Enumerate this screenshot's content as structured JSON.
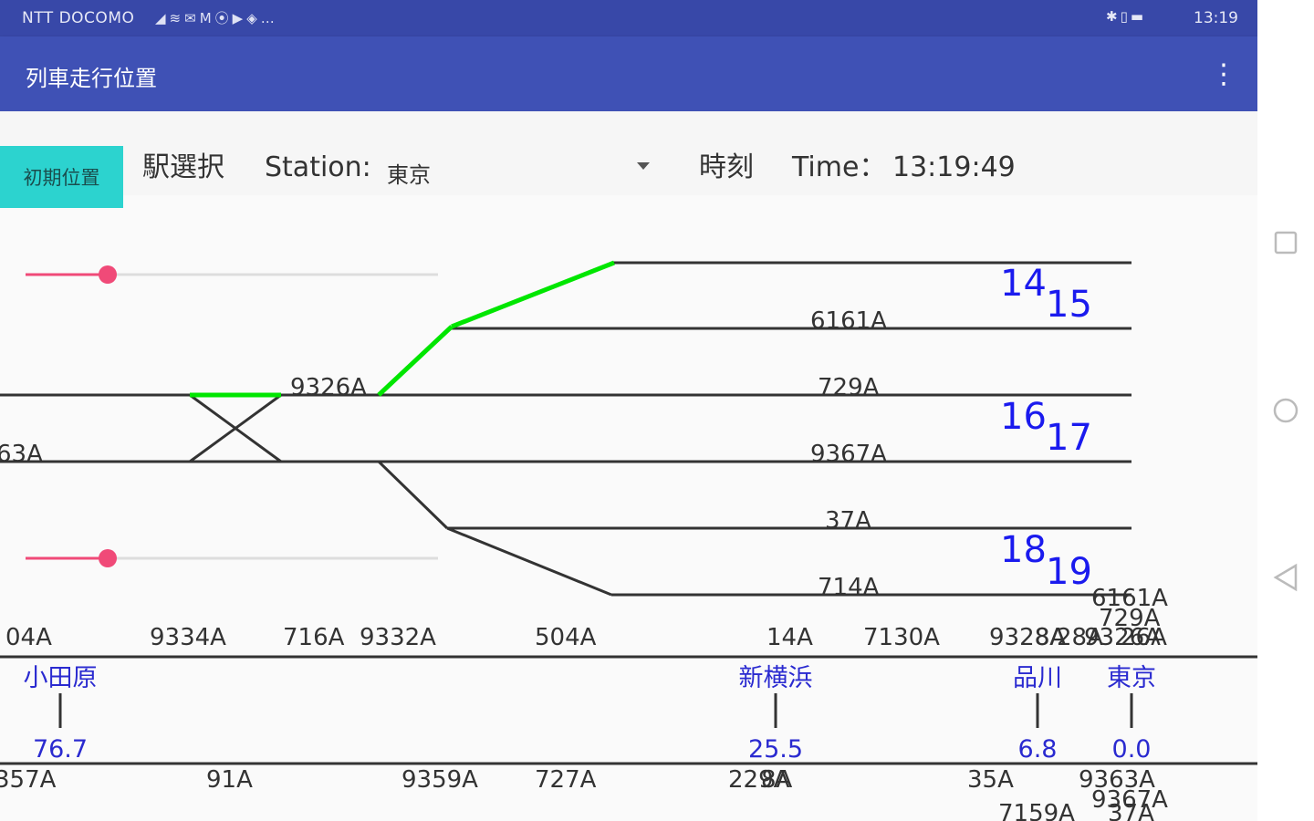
{
  "status_bar": {
    "carrier": "NTT DOCOMO",
    "time": "13:19",
    "signal_icons": [
      "signal-icon",
      "wifi-icon",
      "mail-icon",
      "gmail-icon",
      "record-icon",
      "youtube-icon",
      "dropbox-icon",
      "more-icon"
    ],
    "right_icons": [
      "bluetooth-icon",
      "vibrate-icon",
      "battery-icon"
    ]
  },
  "app_bar": {
    "title": "列車走行位置",
    "menu_icon": "overflow-menu-icon"
  },
  "toolbar": {
    "reset_button": "初期位置",
    "station_select_label": "駅選択",
    "station_label": "Station:",
    "station_value": "東京",
    "time_label_jp": "時刻",
    "time_label": "Time：",
    "time_value": "13:19:49"
  },
  "sliders": [
    {
      "name": "upper-slider",
      "value": 0.2
    },
    {
      "name": "lower-slider",
      "value": 0.2
    }
  ],
  "colors": {
    "status_bar": "#3848a8",
    "app_bar": "#3f51b5",
    "reset_button": "#2cd3cf",
    "active_route": "#00e600",
    "platform_numbers": "#1a1aee",
    "station_labels": "#2a2ad0",
    "slider_accent": "#f04a78"
  },
  "diagram": {
    "platform_pairs": [
      {
        "top": "14",
        "bottom": "15"
      },
      {
        "top": "16",
        "bottom": "17"
      },
      {
        "top": "18",
        "bottom": "19"
      }
    ],
    "track_trains": [
      {
        "label": "6161A"
      },
      {
        "label": "729A"
      },
      {
        "label": "9367A"
      },
      {
        "label": "37A"
      },
      {
        "label": "714A"
      },
      {
        "label": "9326A"
      },
      {
        "label": "63A"
      }
    ],
    "right_stack_trains": [
      {
        "label": "6161A"
      },
      {
        "label": "729A"
      },
      {
        "label": "26A"
      }
    ],
    "upper_row_trains": [
      {
        "label": "04A"
      },
      {
        "label": "9334A"
      },
      {
        "label": "716A"
      },
      {
        "label": "9332A"
      },
      {
        "label": "504A"
      },
      {
        "label": "14A"
      },
      {
        "label": "7130A"
      },
      {
        "label": "9328A"
      },
      {
        "label": "8A"
      },
      {
        "label": "28A"
      },
      {
        "label": "9326A"
      }
    ],
    "stations": [
      {
        "name": "小田原",
        "km": "76.7"
      },
      {
        "name": "新横浜",
        "km": "25.5"
      },
      {
        "name": "品川",
        "km": "6.8"
      },
      {
        "name": "東京",
        "km": "0.0"
      }
    ],
    "lower_row_trains": [
      {
        "label": "357A"
      },
      {
        "label": "91A"
      },
      {
        "label": "9359A"
      },
      {
        "label": "727A"
      },
      {
        "label": "229A"
      },
      {
        "label": "8A"
      },
      {
        "label": "35A"
      },
      {
        "label": "9363A"
      },
      {
        "label": "9367A"
      },
      {
        "label": "7159A"
      },
      {
        "label": "37A"
      }
    ]
  },
  "nav_bar": {
    "icons": [
      "recent-apps-icon",
      "home-icon",
      "back-icon"
    ]
  }
}
